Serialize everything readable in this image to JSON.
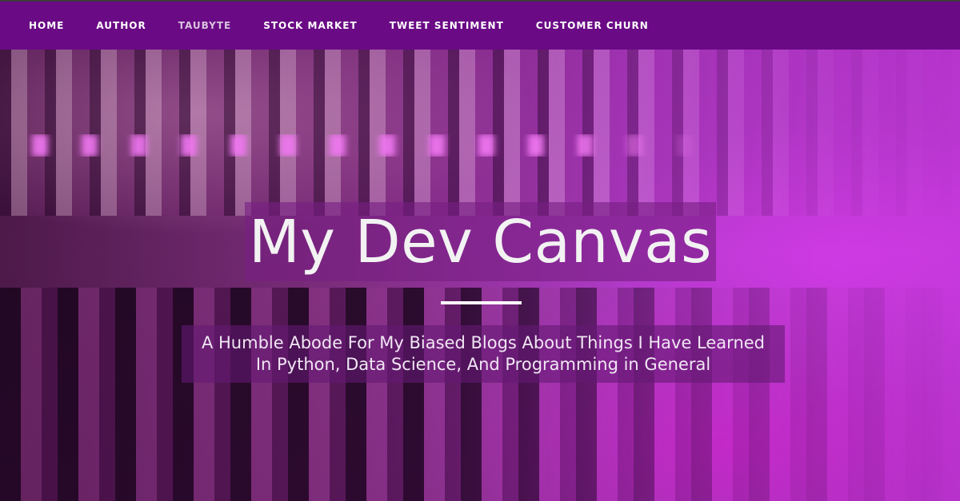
{
  "nav": {
    "items": [
      {
        "label": "HOME"
      },
      {
        "label": "AUTHOR"
      },
      {
        "label": "TAUBYTE"
      },
      {
        "label": "STOCK MARKET"
      },
      {
        "label": "TWEET SENTIMENT"
      },
      {
        "label": "CUSTOMER CHURN"
      }
    ]
  },
  "hero": {
    "title": "My Dev Canvas",
    "subtitle_line1": "A Humble Abode For My Biased Blogs About Things I Have Learned",
    "subtitle_line2": "In Python, Data Science, And Programming in General"
  },
  "colors": {
    "navbar": "#6a0a85",
    "accent": "#c43bdc",
    "text": "#ffffff"
  }
}
